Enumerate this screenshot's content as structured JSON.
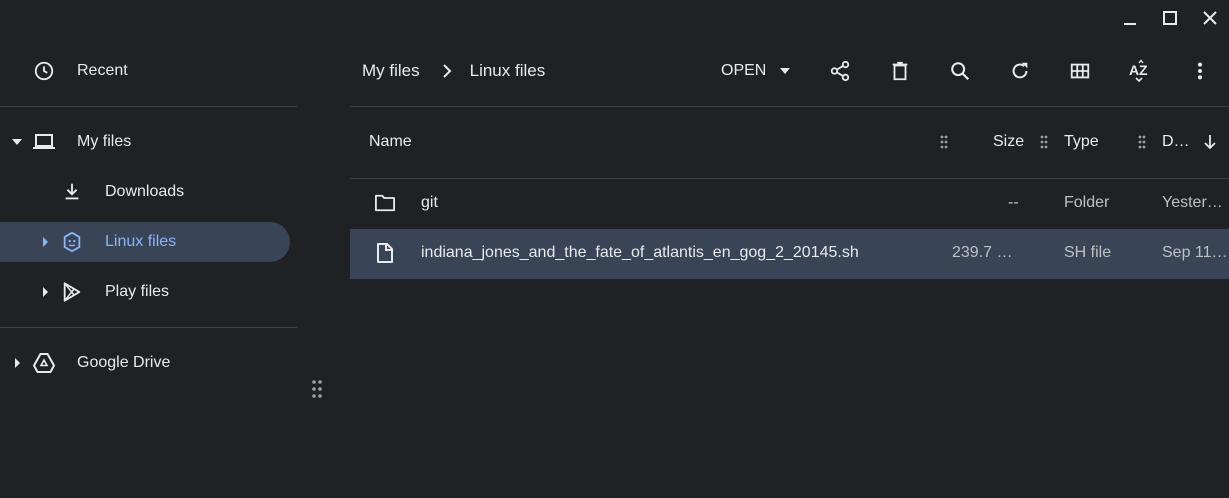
{
  "window": {
    "controls": [
      "minimize-icon",
      "maximize-icon",
      "close-icon"
    ]
  },
  "sidebar": {
    "recent_label": "Recent",
    "my_files_label": "My files",
    "downloads_label": "Downloads",
    "linux_files_label": "Linux files",
    "play_files_label": "Play files",
    "google_drive_label": "Google Drive"
  },
  "breadcrumb": {
    "root": "My files",
    "current": "Linux files"
  },
  "toolbar": {
    "open_label": "OPEN",
    "icons": [
      "share-icon",
      "delete-icon",
      "search-icon",
      "refresh-icon",
      "grid-view-icon",
      "sort-az-icon",
      "more-options-icon"
    ]
  },
  "table": {
    "columns": {
      "name": "Name",
      "size": "Size",
      "type": "Type",
      "date": "D…"
    },
    "rows": [
      {
        "name": "git",
        "size": "--",
        "type": "Folder",
        "date": "Yesterd…",
        "icon": "folder-icon"
      },
      {
        "name": "indiana_jones_and_the_fate_of_atlantis_en_gog_2_20145.sh",
        "size": "239.7 …",
        "type": "SH file",
        "date": "Sep 11,…",
        "icon": "file-icon"
      }
    ]
  },
  "colors": {
    "background": "#202124",
    "selected": "#394457",
    "accent": "#8ab4f8",
    "text": "#e8eaed"
  }
}
